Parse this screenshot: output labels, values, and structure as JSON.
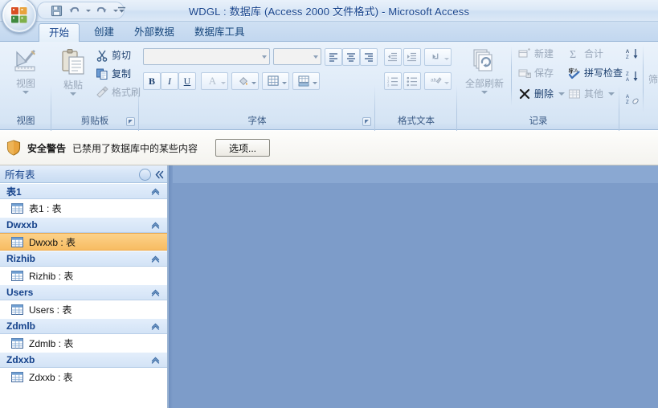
{
  "window": {
    "title": "WDGL : 数据库 (Access 2000 文件格式) - Microsoft Access",
    "office_button": "office-orb"
  },
  "quick_access": {
    "items": [
      {
        "name": "save",
        "icon": "save-icon",
        "label": "保存"
      },
      {
        "name": "undo",
        "icon": "undo-icon",
        "label": "撤消"
      },
      {
        "name": "redo",
        "icon": "redo-icon",
        "label": "恢复"
      }
    ],
    "customize_label": "自定义快速访问工具栏"
  },
  "tabs": [
    {
      "label": "开始",
      "active": true
    },
    {
      "label": "创建",
      "active": false
    },
    {
      "label": "外部数据",
      "active": false
    },
    {
      "label": "数据库工具",
      "active": false
    }
  ],
  "ribbon": {
    "groups": [
      {
        "name": "view",
        "label": "视图",
        "big_button": {
          "label": "视图",
          "icon": "view-design-icon",
          "enabled": false,
          "has_menu": true
        }
      },
      {
        "name": "clipboard",
        "label": "剪贴板",
        "big_button": {
          "label": "粘贴",
          "icon": "paste-icon",
          "enabled": false,
          "has_menu": true
        },
        "small_buttons": [
          {
            "label": "剪切",
            "icon": "scissors-icon",
            "enabled": true
          },
          {
            "label": "复制",
            "icon": "copy-icon",
            "enabled": true
          },
          {
            "label": "格式刷",
            "icon": "format-painter-icon",
            "enabled": false
          }
        ],
        "has_launcher": true
      },
      {
        "name": "font",
        "label": "字体",
        "font_name_value": "",
        "font_size_value": "",
        "align_buttons": [
          {
            "name": "align-left",
            "glyph": "left"
          },
          {
            "name": "align-center",
            "glyph": "center"
          },
          {
            "name": "align-right",
            "glyph": "right"
          }
        ],
        "format_buttons": [
          {
            "name": "bold",
            "label": "B"
          },
          {
            "name": "italic",
            "label": "I"
          },
          {
            "name": "underline",
            "label": "U"
          },
          {
            "name": "font-color",
            "label": "A",
            "has_menu": true
          },
          {
            "name": "fill-color",
            "label": "fill",
            "has_menu": true
          },
          {
            "name": "gridlines",
            "label": "grid",
            "has_menu": true
          },
          {
            "name": "alternate-fill-color",
            "label": "altfill",
            "has_menu": true
          }
        ],
        "has_launcher": true
      },
      {
        "name": "rich-text",
        "label": "格式文本",
        "buttons": [
          {
            "name": "decrease-indent",
            "enabled": false
          },
          {
            "name": "increase-indent",
            "enabled": false
          },
          {
            "name": "text-direction",
            "enabled": false,
            "has_menu": true
          },
          {
            "name": "numbered-list",
            "enabled": false
          },
          {
            "name": "bulleted-list",
            "enabled": false
          },
          {
            "name": "text-highlight",
            "enabled": false,
            "has_menu": true
          }
        ]
      },
      {
        "name": "records",
        "label": "记录",
        "big_button": {
          "label": "全部刷新",
          "icon": "refresh-all-icon",
          "enabled": false,
          "has_menu": true
        },
        "column_one": [
          {
            "label": "新建",
            "icon": "new-record-icon",
            "enabled": false
          },
          {
            "label": "保存",
            "icon": "save-record-icon",
            "enabled": false
          },
          {
            "label": "删除",
            "icon": "delete-icon",
            "enabled": true,
            "has_menu": true
          }
        ],
        "column_two": [
          {
            "label": "合计",
            "icon": "sigma-icon",
            "enabled": false
          },
          {
            "label": "拼写检查",
            "icon": "spelling-icon",
            "enabled": true
          },
          {
            "label": "其他",
            "icon": "more-icon",
            "enabled": false,
            "has_menu": true
          }
        ]
      },
      {
        "name": "sort-filter",
        "label": "",
        "buttons": [
          {
            "name": "sort-ascending",
            "label": "升序"
          },
          {
            "name": "sort-descending",
            "label": "降序"
          },
          {
            "name": "clear-sort",
            "label": "清除排序"
          }
        ],
        "filter_label": "筛"
      }
    ]
  },
  "security_bar": {
    "icon": "shield-icon",
    "label": "安全警告",
    "message": "已禁用了数据库中的某些内容",
    "button": "选项..."
  },
  "nav_pane": {
    "header": "所有表",
    "header_menu_icon": "circle-chevron-down-icon",
    "collapse_icon": "double-chevron-left-icon",
    "groups": [
      {
        "name": "表1",
        "collapse_icon": "chevron-up-icon",
        "items": [
          {
            "label": "表1 : 表",
            "icon": "table-icon",
            "selected": false
          }
        ]
      },
      {
        "name": "Dwxxb",
        "collapse_icon": "chevron-up-icon",
        "items": [
          {
            "label": "Dwxxb : 表",
            "icon": "table-icon",
            "selected": true
          }
        ]
      },
      {
        "name": "Rizhib",
        "collapse_icon": "chevron-up-icon",
        "items": [
          {
            "label": "Rizhib : 表",
            "icon": "table-icon",
            "selected": false
          }
        ]
      },
      {
        "name": "Users",
        "collapse_icon": "chevron-up-icon",
        "items": [
          {
            "label": "Users : 表",
            "icon": "table-icon",
            "selected": false
          }
        ]
      },
      {
        "name": "Zdmlb",
        "collapse_icon": "chevron-up-icon",
        "items": [
          {
            "label": "Zdmlb : 表",
            "icon": "table-icon",
            "selected": false
          }
        ]
      },
      {
        "name": "Zdxxb",
        "collapse_icon": "chevron-up-icon",
        "items": [
          {
            "label": "Zdxxb : 表",
            "icon": "table-icon",
            "selected": false
          }
        ]
      }
    ]
  },
  "colors": {
    "title_text": "#15428b",
    "ribbon_bg": "#e2edf9",
    "selection_highlight": "#f7bc62",
    "workspace": "#7d9cc9",
    "workspace_top": "#8aa8d2",
    "nav_group_header": "#d3e3f6"
  }
}
